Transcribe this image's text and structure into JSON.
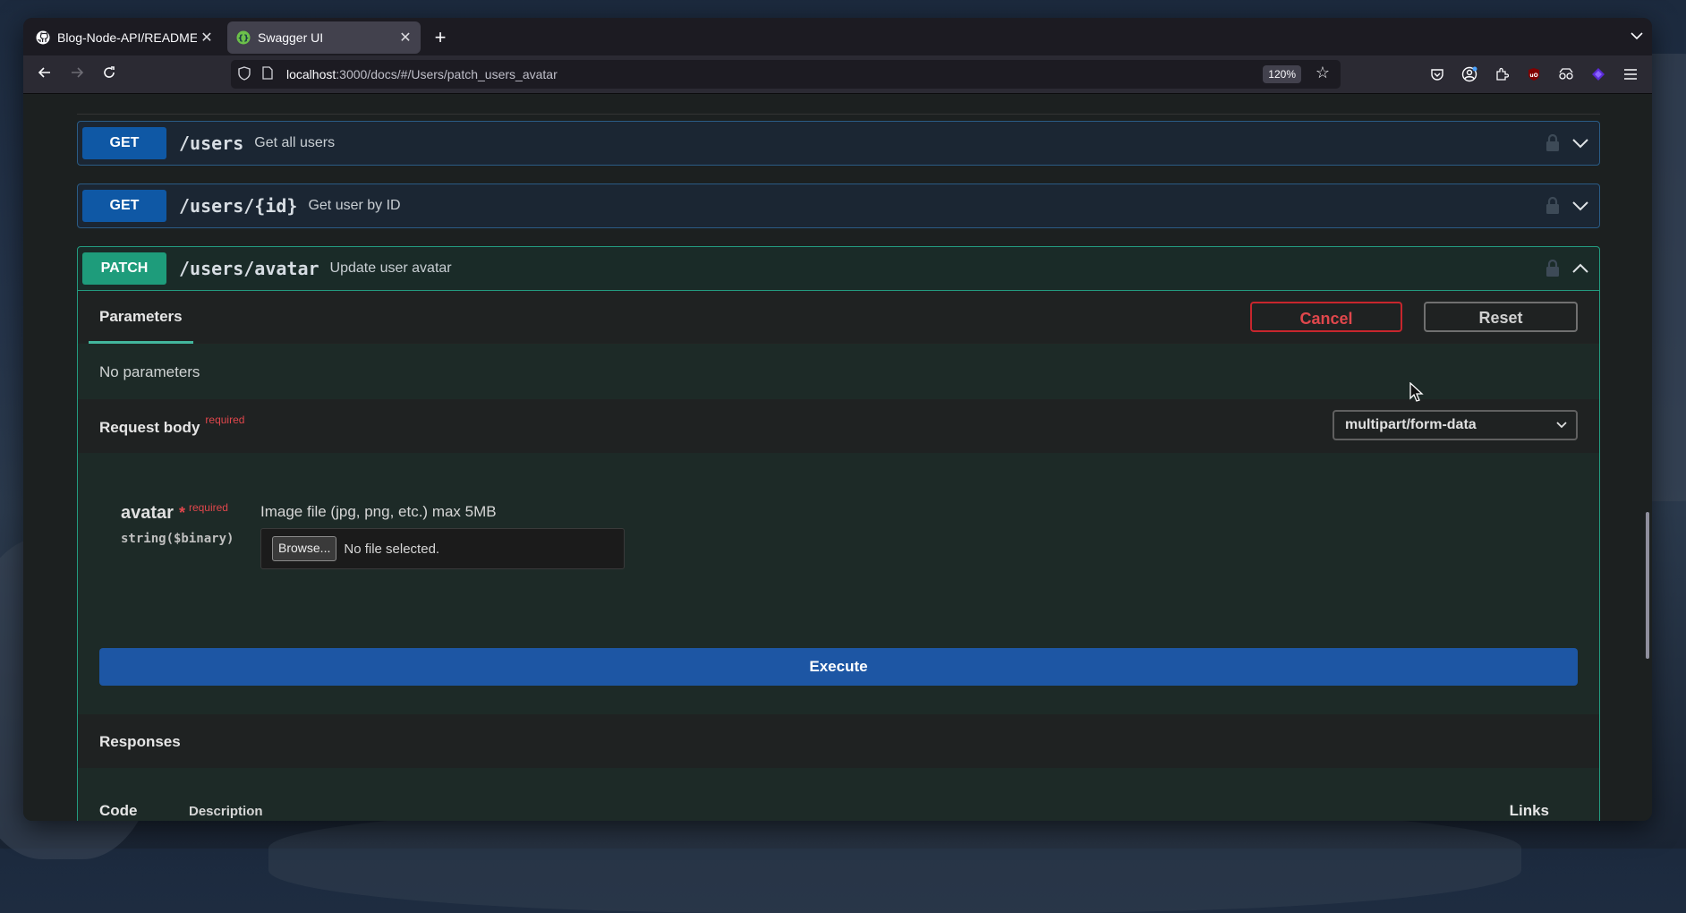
{
  "browser": {
    "tabs": [
      {
        "title": "Blog-Node-API/README.m",
        "favicon": "github-icon",
        "active": false
      },
      {
        "title": "Swagger UI",
        "favicon": "swagger-icon",
        "active": true
      }
    ],
    "new_tab_label": "+",
    "address": {
      "host": "localhost",
      "rest": ":3000/docs/#/Users/patch_users_avatar"
    },
    "zoom": "120%"
  },
  "swagger": {
    "operations": [
      {
        "method": "GET",
        "path": "/users",
        "summary": "Get all users",
        "expanded": false
      },
      {
        "method": "GET",
        "path": "/users/{id}",
        "summary": "Get user by ID",
        "expanded": false
      },
      {
        "method": "PATCH",
        "path": "/users/avatar",
        "summary": "Update user avatar",
        "expanded": true
      }
    ],
    "expanded": {
      "parameters_tab": "Parameters",
      "cancel_label": "Cancel",
      "reset_label": "Reset",
      "no_parameters": "No parameters",
      "request_body_title": "Request body",
      "required_label": "required",
      "content_type": "multipart/form-data",
      "field": {
        "name": "avatar",
        "star": "*",
        "required": "required",
        "type": "string($binary)",
        "description": "Image file (jpg, png, etc.) max 5MB",
        "browse_label": "Browse...",
        "file_status": "No file selected."
      },
      "execute_label": "Execute",
      "responses_title": "Responses",
      "columns": {
        "code": "Code",
        "description": "Description",
        "links": "Links"
      }
    }
  },
  "colors": {
    "get": "#0f58a5",
    "patch": "#1e9c7b",
    "cancel": "#c7262d",
    "execute": "#1d56a4"
  }
}
